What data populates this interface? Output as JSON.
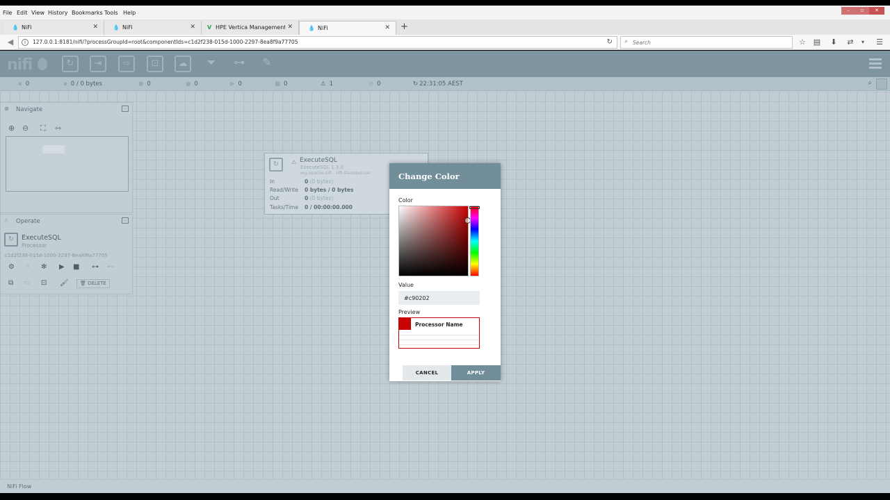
{
  "browser": {
    "menu": [
      "File",
      "Edit",
      "View",
      "History",
      "Bookmarks",
      "Tools",
      "Help"
    ],
    "tabs": [
      {
        "label": "NiFi",
        "icon": "nifi-drop-icon"
      },
      {
        "label": "NiFi",
        "icon": "nifi-drop-icon"
      },
      {
        "label": "HPE Vertica Management C...",
        "icon": "vertica-icon"
      },
      {
        "label": "NiFi",
        "icon": "nifi-drop-icon"
      }
    ],
    "url": "127.0.0.1:8181/nifi/?processGroupId=root&componentIds=c1d2f238-015d-1000-2297-8ea8f9a77705",
    "search_placeholder": "Search"
  },
  "nifi": {
    "logo": "nifi",
    "status": {
      "active_threads": "0",
      "queued": "0 / 0 bytes",
      "transmitting": "0",
      "not_transmitting": "0",
      "running": "0",
      "stopped": "0",
      "invalid": "1",
      "disabled": "0",
      "refreshed": "22:31:05 AEST"
    },
    "footer": "NiFi Flow"
  },
  "navigate": {
    "title": "Navigate"
  },
  "operate": {
    "title": "Operate",
    "component_name": "ExecuteSQL",
    "component_type": "Processor",
    "component_id": "c1d2f238-015d-1000-2297-8ea8f9a77705",
    "delete_label": "DELETE"
  },
  "processor": {
    "name": "ExecuteSQL",
    "type": "ExecuteSQL 1.3.0",
    "bundle": "org.apache.nifi - nifi-standard-nar",
    "rows": [
      {
        "key": "In",
        "value": "0",
        "detail": "(0 bytes)"
      },
      {
        "key": "Read/Write",
        "value": "0 bytes / 0 bytes",
        "detail": ""
      },
      {
        "key": "Out",
        "value": "0",
        "detail": "(0 bytes)"
      },
      {
        "key": "Tasks/Time",
        "value": "0 / 00:00:00.000",
        "detail": ""
      }
    ]
  },
  "dialog": {
    "title": "Change Color",
    "color_label": "Color",
    "value_label": "Value",
    "value": "#c90202",
    "preview_label": "Preview",
    "preview_name": "Processor Name",
    "cancel": "CANCEL",
    "apply": "APPLY",
    "selected_color": "#c90202"
  }
}
